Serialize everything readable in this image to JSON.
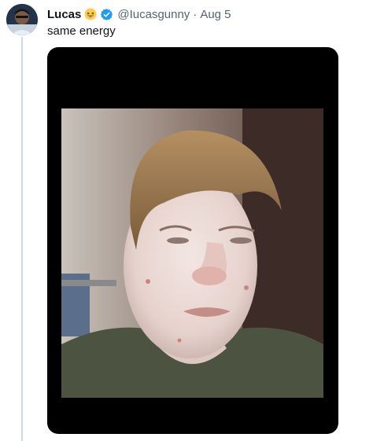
{
  "tweet": {
    "author_name": "Lucas",
    "name_emoji": "grinning-squinting-face-emoji",
    "verified_icon": "verified-badge-icon",
    "handle": "@Iucasgunny",
    "separator": "·",
    "timestamp": "Aug 5",
    "text": "same energy"
  },
  "media": {
    "type": "photo",
    "subject": "selfie-photo"
  },
  "colors": {
    "text_primary": "#0f1419",
    "text_secondary": "#536471",
    "verified_blue": "#1d9bf0",
    "thread_line": "#cfd9de",
    "media_background": "#000000"
  }
}
